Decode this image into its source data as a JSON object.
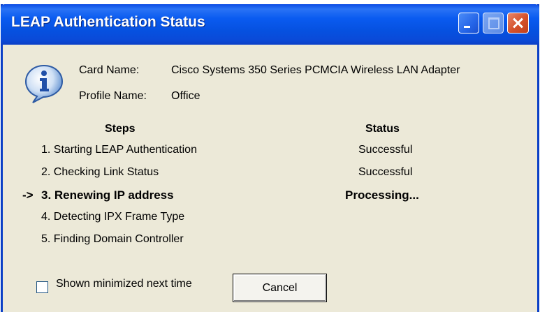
{
  "window": {
    "title": "LEAP Authentication Status"
  },
  "icons": {
    "dialog_icon": "info-icon",
    "titlebar": [
      "minimize-icon",
      "maximize-icon",
      "close-icon"
    ]
  },
  "info": {
    "card_name_label": "Card Name:",
    "card_name_value": "Cisco Systems 350 Series PCMCIA Wireless LAN Adapter",
    "profile_name_label": "Profile Name:",
    "profile_name_value": "Office"
  },
  "table": {
    "steps_header": "Steps",
    "status_header": "Status",
    "current_marker": "->",
    "steps": [
      "1. Starting LEAP Authentication",
      "2. Checking Link Status",
      "3. Renewing IP address",
      "4. Detecting IPX Frame Type",
      "5. Finding Domain Controller"
    ],
    "statuses": [
      "Successful",
      "Successful",
      "Processing..."
    ]
  },
  "footer": {
    "checkbox_label": "Shown minimized next time",
    "checkbox_checked": false,
    "cancel_label": "Cancel"
  },
  "colors": {
    "titlebar": "#0a5bf0",
    "dialog_background": "#ece9d8",
    "close_button": "#d4502a"
  }
}
